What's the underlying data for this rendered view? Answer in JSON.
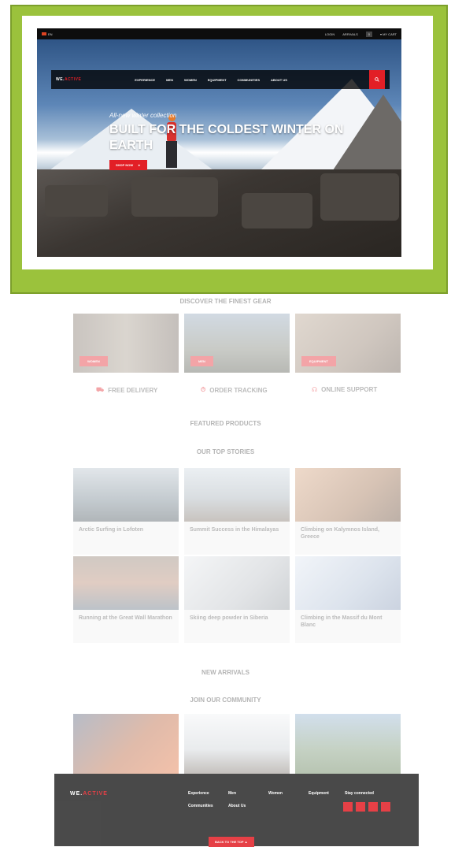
{
  "topbar": {
    "lang": "EN",
    "links": [
      "LOGIN",
      "ARRIVALS",
      "MY CART"
    ],
    "cart_count": "0"
  },
  "nav": {
    "logo_a": "WE.",
    "logo_b": "ACTIVE",
    "links": [
      "EXPERIENCE",
      "MEN",
      "WOMEN",
      "EQUIPMENT",
      "COMMUNITIES",
      "ABOUT US"
    ]
  },
  "hero": {
    "subtitle": "All-new winter collection",
    "title": "BUILT FOR THE COLDEST WINTER ON EARTH",
    "cta": "SHOP NOW"
  },
  "sections": {
    "discover": "DISCOVER THE FINEST GEAR",
    "featured": "FEATURED PRODUCTS",
    "stories": "OUR TOP STORIES",
    "new_arrivals": "NEW ARRIVALS",
    "community": "JOIN OUR COMMUNITY"
  },
  "gear_cards": [
    {
      "label": "WOMEN"
    },
    {
      "label": "MEN"
    },
    {
      "label": "EQUIPMENT"
    }
  ],
  "features": [
    {
      "label": "FREE DELIVERY"
    },
    {
      "label": "ORDER TRACKING"
    },
    {
      "label": "ONLINE SUPPORT"
    }
  ],
  "stories": [
    {
      "title": "Arctic Surfing in Lofoten",
      "color": "#9aa8b2"
    },
    {
      "title": "Summit Success in the Himalayas",
      "color": "#b9c4cc"
    },
    {
      "title": "Climbing on Kalymnos Island, Greece",
      "color": "#c08860"
    },
    {
      "title": "Running at the Great Wall Marathon",
      "color": "#a07060"
    },
    {
      "title": "Skiing deep powder in Siberia",
      "color": "#d6d9dc"
    },
    {
      "title": "Climbing in the Massif du Mont Blanc",
      "color": "#cfd8e6"
    }
  ],
  "footer": {
    "logo_a": "WE.",
    "logo_b": "ACTIVE",
    "links": [
      "Experience",
      "Men",
      "Women",
      "Equipment",
      "Communities",
      "About Us"
    ],
    "social_title": "Stay connected",
    "top_button": "BACK TO THE TOP"
  },
  "colors": {
    "accent": "#e21f26",
    "frame": "#9bc23c"
  }
}
